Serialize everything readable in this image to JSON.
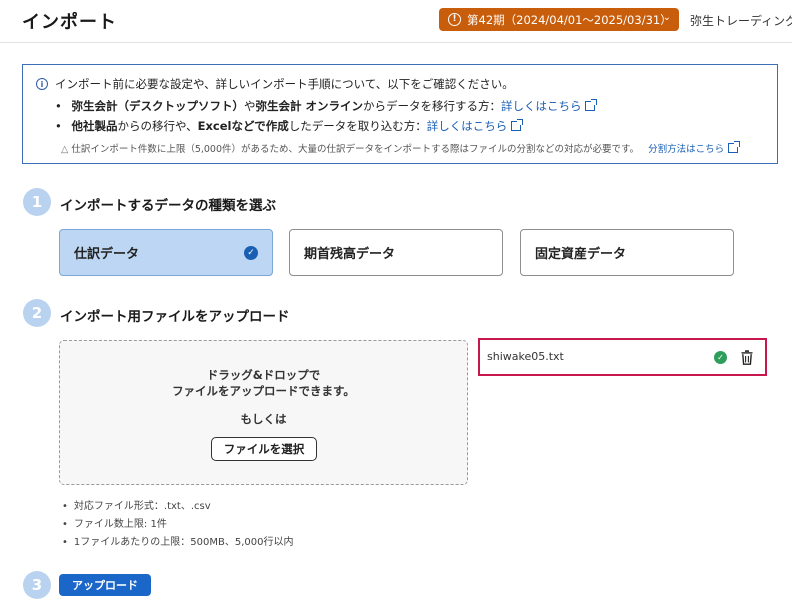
{
  "header": {
    "title": "インポート",
    "period_label": "第42期（2024/04/01～2025/03/31）",
    "company_name": "弥生トレーディング"
  },
  "notice": {
    "intro": "インポート前に必要な設定や、詳しいインポート手順について、以下をご確認ください。",
    "bullet1": {
      "bold1": "弥生会計（デスクトップソフト）",
      "text1": "や",
      "bold2": "弥生会計 オンライン",
      "text2": "からデータを移行する方：",
      "link": "詳しくはこちら"
    },
    "bullet2": {
      "bold1": "他社製品",
      "text1": "からの移行や、",
      "bold2": "Excelなどで作成",
      "text2": "したデータを取り込む方：",
      "link": "詳しくはこちら"
    },
    "warning": "仕訳インポート件数に上限（5,000件）があるため、大量の仕訳データをインポートする際はファイルの分割などの対応が必要です。",
    "warning_link": "分割方法はこちら"
  },
  "step1": {
    "number": "1",
    "label": "インポートするデータの種類を選ぶ",
    "options": [
      {
        "label": "仕訳データ",
        "selected": true
      },
      {
        "label": "期首残高データ",
        "selected": false
      },
      {
        "label": "固定資産データ",
        "selected": false
      }
    ]
  },
  "step2": {
    "number": "2",
    "label": "インポート用ファイルをアップロード",
    "dropzone": {
      "line1": "ドラッグ&ドロップで",
      "line2": "ファイルをアップロードできます。",
      "or": "もしくは",
      "button": "ファイルを選択"
    },
    "file_name": "shiwake05.txt",
    "specs": [
      "対応ファイル形式：.txt、.csv",
      "ファイル数上限: 1件",
      "1ファイルあたりの上限：500MB、5,000行以内"
    ]
  },
  "step3": {
    "number": "3",
    "button": "アップロード"
  },
  "colors": {
    "period_bg": "#c85d0b",
    "primary": "#1a66c9",
    "selected_card": "#bcd6f3",
    "step_circle": "#b8d2ef",
    "highlight_border": "#c8174d",
    "success": "#2e9f5a"
  }
}
